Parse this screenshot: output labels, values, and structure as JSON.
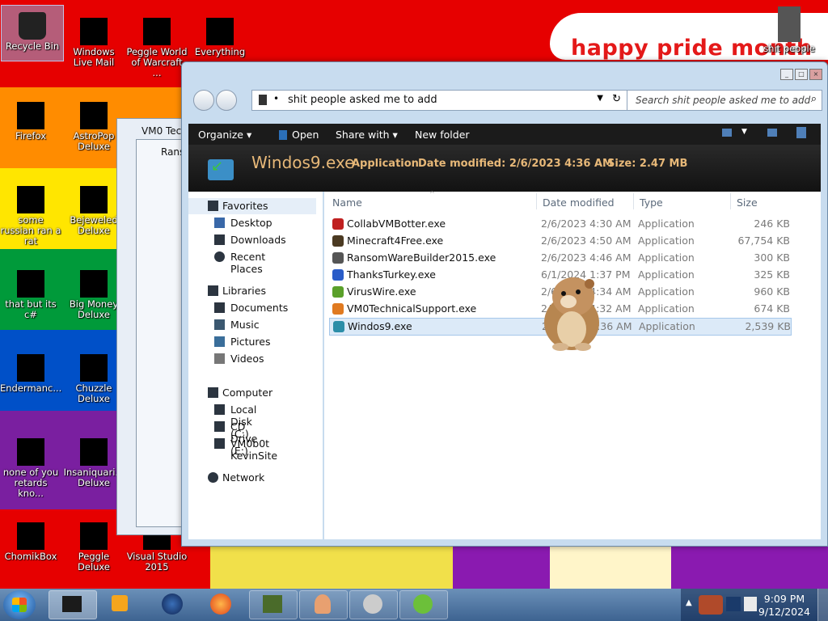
{
  "wallpaper": {
    "banner_text": "happy pride month",
    "stripe_colors": [
      "#e60000",
      "#ff8c00",
      "#ffe600",
      "#009a3a",
      "#0050c8",
      "#7a1fa0"
    ]
  },
  "desktop_icons": [
    {
      "label": "Recycle Bin",
      "icon": "recycle-bin-icon"
    },
    {
      "label": "Windows Live Mail",
      "icon": "mail-icon"
    },
    {
      "label": "Peggle World of Warcraft ...",
      "icon": "peggle-icon"
    },
    {
      "label": "Everything",
      "icon": "search-icon"
    },
    {
      "label": "Firefox",
      "icon": "firefox-icon"
    },
    {
      "label": "AstroPop Deluxe",
      "icon": "astropop-icon"
    },
    {
      "label": "some russian ran a rat",
      "icon": "ie-icon"
    },
    {
      "label": "Bejeweled Deluxe",
      "icon": "gem-icon"
    },
    {
      "label": "that but its c#",
      "icon": "copy-icon"
    },
    {
      "label": "Big Money Deluxe",
      "icon": "money-icon"
    },
    {
      "label": "Endermanc...",
      "icon": "console-icon"
    },
    {
      "label": "Chuzzle Deluxe",
      "icon": "chuzzle-icon"
    },
    {
      "label": "none of you retards kno...",
      "icon": "chrome-icon"
    },
    {
      "label": "Insaniquari... Deluxe",
      "icon": "fish-icon"
    },
    {
      "label": "ChomikBox",
      "icon": "hamster-icon"
    },
    {
      "label": "Peggle Deluxe",
      "icon": "peggle-icon"
    },
    {
      "label": "Visual Studio 2015",
      "icon": "vs-icon"
    },
    {
      "label": "shit people",
      "icon": "folder-icon"
    }
  ],
  "background_windows": {
    "win1_title": "VM0 Tech",
    "win2_title": "Rans"
  },
  "explorer": {
    "address": "shit people asked me to add",
    "search_placeholder": "Search shit people asked me to add",
    "toolbar": {
      "organize": "Organize",
      "open": "Open",
      "share_with": "Share with",
      "new_folder": "New folder"
    },
    "details": {
      "name": "Windos9.exe",
      "type": "Application",
      "date_modified": "Date modified: 2/6/2023 4:36 AM",
      "size": "Size: 2.47 MB"
    },
    "nav": {
      "favorites": "Favorites",
      "desktop": "Desktop",
      "downloads": "Downloads",
      "recent_places": "Recent Places",
      "libraries": "Libraries",
      "documents": "Documents",
      "music": "Music",
      "pictures": "Pictures",
      "videos": "Videos",
      "computer": "Computer",
      "local_disk": "Local Disk (C:)",
      "cd_drive": "CD Drive (E:)",
      "vm_site": "VM0b0t KevinSite",
      "network": "Network"
    },
    "columns": {
      "name": "Name",
      "date": "Date modified",
      "type": "Type",
      "size": "Size"
    },
    "files": [
      {
        "name": "CollabVMBotter.exe",
        "date": "2/6/2023 4:30 AM",
        "type": "Application",
        "size": "246 KB",
        "color": "#c02020"
      },
      {
        "name": "Minecraft4Free.exe",
        "date": "2/6/2023 4:50 AM",
        "type": "Application",
        "size": "67,754 KB",
        "color": "#4b3a22"
      },
      {
        "name": "RansomWareBuilder2015.exe",
        "date": "2/6/2023 4:46 AM",
        "type": "Application",
        "size": "300 KB",
        "color": "#555555"
      },
      {
        "name": "ThanksTurkey.exe",
        "date": "6/1/2024 1:37 PM",
        "type": "Application",
        "size": "325 KB",
        "color": "#2a5cc8"
      },
      {
        "name": "VirusWire.exe",
        "date": "2/6/2023 4:34 AM",
        "type": "Application",
        "size": "960 KB",
        "color": "#5aa02a"
      },
      {
        "name": "VM0TechnicalSupport.exe",
        "date": "2/6/2023 4:32 AM",
        "type": "Application",
        "size": "674 KB",
        "color": "#e07a20"
      },
      {
        "name": "Windos9.exe",
        "date": "2/6/2023 4:36 AM",
        "type": "Application",
        "size": "2,539 KB",
        "color": "#2c8ea8",
        "selected": true
      }
    ]
  },
  "taskbar": {
    "time": "9:09 PM",
    "date": "9/12/2024"
  }
}
